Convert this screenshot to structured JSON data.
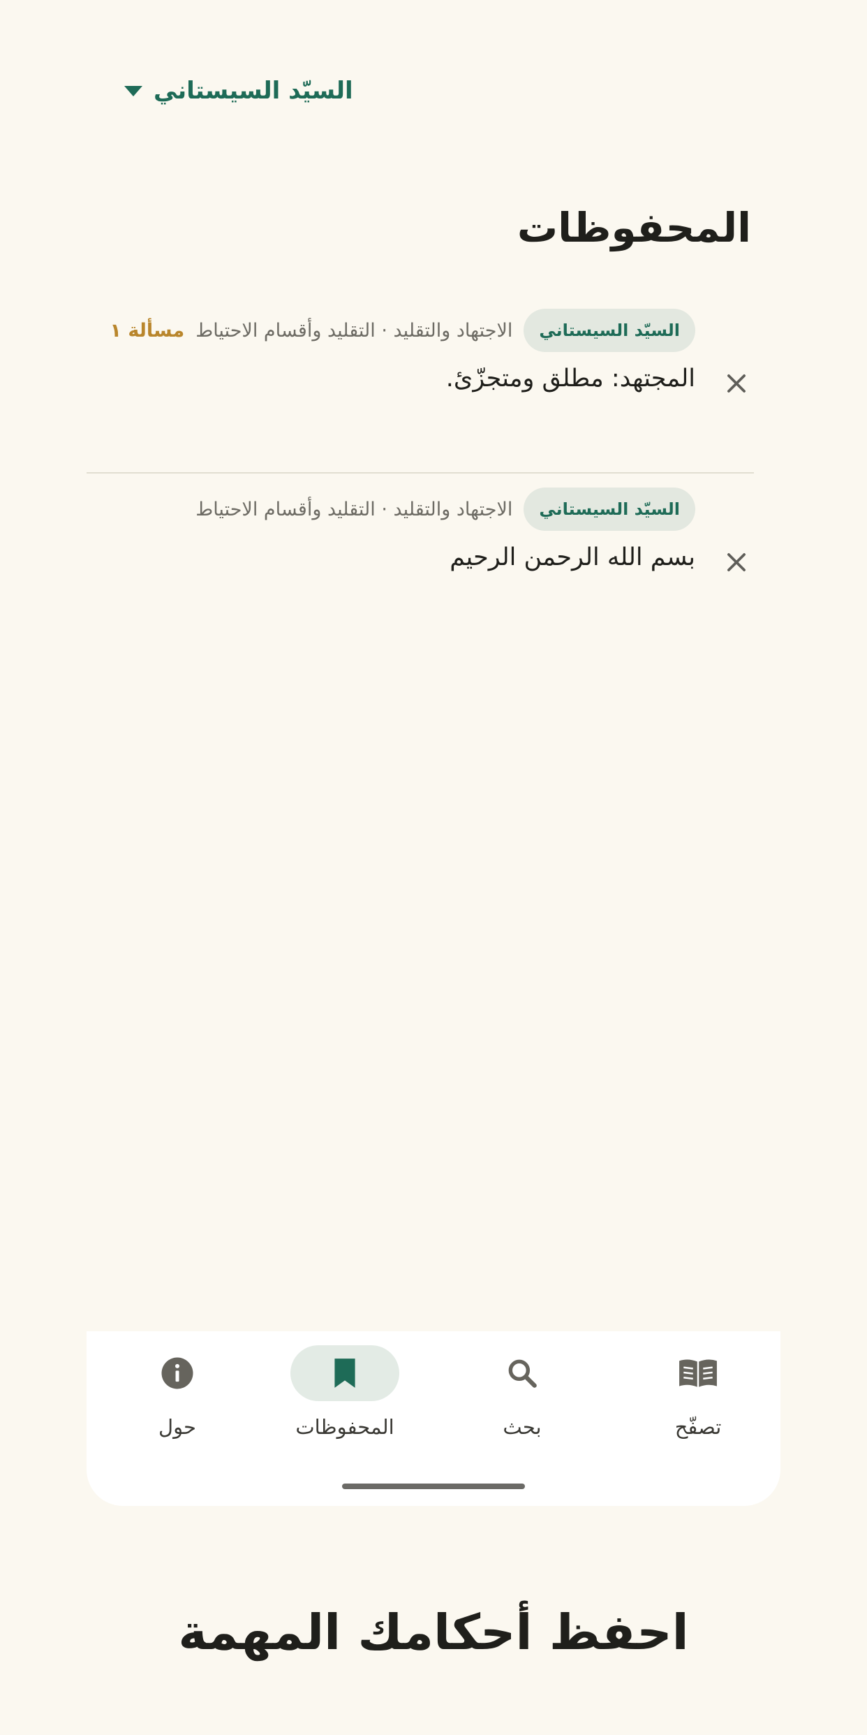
{
  "header": {
    "marja_selector_label": "السيّد السيستاني",
    "page_title": "المحفوظات"
  },
  "saved_items": [
    {
      "source_chip": "السيّد السيستاني",
      "breadcrumb": "الاجتهاد والتقليد · التقليد وأقسام الاحتياط",
      "issue_label": "مسألة ١",
      "text": "المجتهد: مطلق ومتجزّئ."
    },
    {
      "source_chip": "السيّد السيستاني",
      "breadcrumb": "الاجتهاد والتقليد · التقليد وأقسام الاحتياط",
      "text": "بسم الله الرحمن الرحيم"
    }
  ],
  "bottom_nav": {
    "items": [
      {
        "label": "حول",
        "icon": "info-icon",
        "active": false
      },
      {
        "label": "المحفوظات",
        "icon": "bookmark-icon",
        "active": true
      },
      {
        "label": "بحث",
        "icon": "search-icon",
        "active": false
      },
      {
        "label": "تصفّح",
        "icon": "book-icon",
        "active": false
      }
    ]
  },
  "promo_caption": "احفظ أحكامك المهمة",
  "colors": {
    "background": "#fbf8f0",
    "accent_green": "#1e6b57",
    "chip_background": "#e3e8e0",
    "issue_gold": "#b9862c",
    "nav_background": "#ffffff"
  }
}
